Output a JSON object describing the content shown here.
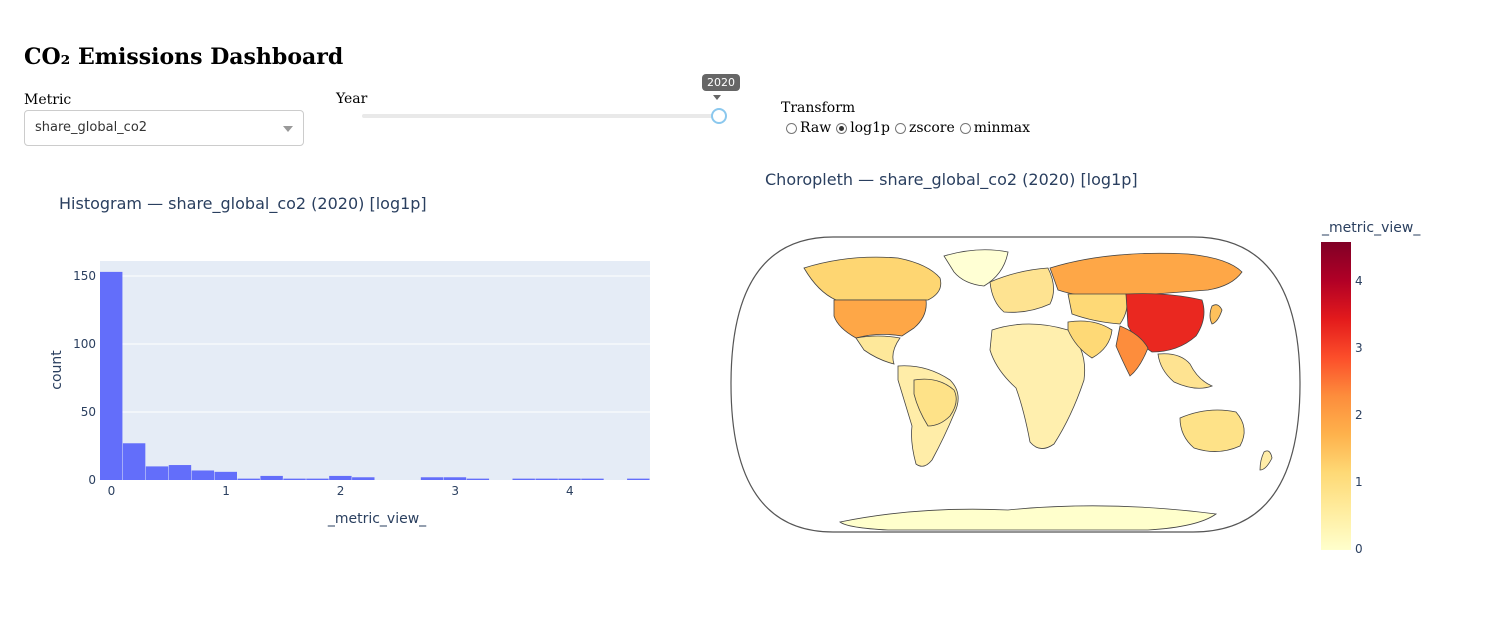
{
  "header": {
    "title": "CO₂ Emissions Dashboard"
  },
  "controls": {
    "metric": {
      "label": "Metric",
      "value": "share_global_co2"
    },
    "year": {
      "label": "Year",
      "value": "2020",
      "fraction": 1.0
    },
    "transform": {
      "label": "Transform",
      "options": [
        {
          "label": "Raw",
          "checked": false
        },
        {
          "label": "log1p",
          "checked": true
        },
        {
          "label": "zscore",
          "checked": false
        },
        {
          "label": "minmax",
          "checked": false
        }
      ]
    }
  },
  "histogram": {
    "title": "Histogram — share_global_co2 (2020) [log1p]",
    "bar_color": "#636efa",
    "plot_bg": "#e5ecf6"
  },
  "choropleth": {
    "title": "Choropleth — share_global_co2 (2020) [log1p]",
    "colorbar_title": "_metric_view_",
    "colorscale": [
      "#ffffcc",
      "#ffeda0",
      "#fed976",
      "#feb24c",
      "#fd8d3c",
      "#fc4e2a",
      "#e31a1c",
      "#b10026",
      "#800026"
    ],
    "colorbar_ticks": [
      "0",
      "1",
      "2",
      "3",
      "4"
    ],
    "regions": [
      {
        "name": "China",
        "level": 3.3
      },
      {
        "name": "India",
        "level": 2.3
      },
      {
        "name": "United States",
        "level": 1.9
      },
      {
        "name": "Russia",
        "level": 1.9
      },
      {
        "name": "Japan",
        "level": 1.5
      },
      {
        "name": "Canada",
        "level": 1.2
      },
      {
        "name": "Brazil",
        "level": 0.9
      },
      {
        "name": "Australia",
        "level": 0.9
      },
      {
        "name": "Antarctica",
        "level": 0.0
      }
    ]
  },
  "chart_data": {
    "type": "bar",
    "title": "Histogram — share_global_co2 (2020) [log1p]",
    "xlabel": "_metric_view_",
    "ylabel": "count",
    "x_ticks": [
      "0",
      "1",
      "2",
      "3",
      "4"
    ],
    "y_ticks": [
      "0",
      "50",
      "100",
      "150"
    ],
    "xlim": [
      -0.1,
      4.7
    ],
    "ylim": [
      0,
      161
    ],
    "bin_width": 0.2,
    "bin_starts": [
      -0.1,
      0.1,
      0.3,
      0.5,
      0.7,
      0.9,
      1.1,
      1.3,
      1.5,
      1.7,
      1.9,
      2.1,
      2.3,
      2.5,
      2.7,
      2.9,
      3.1,
      3.3,
      3.5,
      3.7,
      3.9,
      4.1,
      4.3,
      4.5
    ],
    "values": [
      153,
      27,
      10,
      11,
      7,
      6,
      1,
      3,
      1,
      1,
      3,
      2,
      0,
      0,
      2,
      2,
      1,
      0,
      1,
      1,
      1,
      1,
      0,
      1
    ],
    "grid": true
  }
}
